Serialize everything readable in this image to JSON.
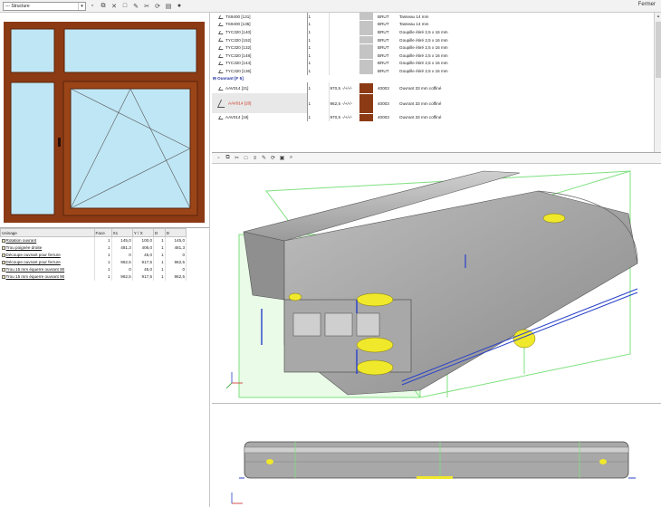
{
  "toolbar": {
    "structure_value": "--- Structure",
    "close_label": "Fermer"
  },
  "attributes": {
    "columns": [
      "Usinage",
      "Face",
      "X1",
      "Y / X",
      "D",
      "D"
    ],
    "rows": [
      {
        "label": "Rotation ouvrant",
        "face": "1",
        "x1": "145,0",
        "y": "100,0",
        "d1": "1",
        "d2": "145,0"
      },
      {
        "label": "Trou poignée droite",
        "face": "1",
        "x1": "481,3",
        "y": "406,0",
        "d1": "1",
        "d2": "481,3"
      },
      {
        "label": "Découpe ouvrant pour ferrure",
        "face": "1",
        "x1": "0",
        "y": "45,0",
        "d1": "1",
        "d2": "0"
      },
      {
        "label": "Découpe ouvrant pour ferrure",
        "face": "1",
        "x1": "962,5",
        "y": "917,5",
        "d1": "1",
        "d2": "962,5"
      },
      {
        "label": "Trou 15 mm équerre ouvrant 90",
        "face": "1",
        "x1": "0",
        "y": "45,0",
        "d1": "1",
        "d2": "0"
      },
      {
        "label": "Trou 15 mm équerre ouvrant 90",
        "face": "1",
        "x1": "962,5",
        "y": "917,5",
        "d1": "1",
        "d2": "962,5"
      }
    ]
  },
  "profiles": {
    "rows": [
      {
        "name": "TS9400 [131]",
        "qty": "1",
        "len": "",
        "ang": "",
        "swatch": "#c4c4c4",
        "finish": "BRUT",
        "desc": "Tasseau 14 mm"
      },
      {
        "name": "TS9400 [135]",
        "qty": "1",
        "len": "",
        "ang": "",
        "swatch": "#c4c4c4",
        "finish": "BRUT",
        "desc": "Tasseau 14 mm"
      },
      {
        "name": "TYC320 [140]",
        "qty": "1",
        "len": "",
        "ang": "",
        "swatch": "#c4c4c4",
        "finish": "BRUT",
        "desc": "Goupille étiré 2,5 x 16 mm"
      },
      {
        "name": "TYC320 [152]",
        "qty": "1",
        "len": "",
        "ang": "",
        "swatch": "#c4c4c4",
        "finish": "BRUT",
        "desc": "Goupille étiré 2,5 x 16 mm"
      },
      {
        "name": "TYC320 [132]",
        "qty": "1",
        "len": "",
        "ang": "",
        "swatch": "#c4c4c4",
        "finish": "BRUT",
        "desc": "Goupille étiré 2,5 x 16 mm"
      },
      {
        "name": "TYC320 [148]",
        "qty": "1",
        "len": "",
        "ang": "",
        "swatch": "#c4c4c4",
        "finish": "BRUT",
        "desc": "Goupille étiré 2,5 x 16 mm"
      },
      {
        "name": "TYC320 [144]",
        "qty": "1",
        "len": "",
        "ang": "",
        "swatch": "#c4c4c4",
        "finish": "BRUT",
        "desc": "Goupille étiré 2,5 x 16 mm"
      },
      {
        "name": "TYC320 [136]",
        "qty": "1",
        "len": "",
        "ang": "",
        "swatch": "#c4c4c4",
        "finish": "BRUT",
        "desc": "Goupille étiré 2,5 x 16 mm"
      }
    ],
    "group_label": "Ouvrant [F 5]",
    "group_rows": [
      {
        "name": "AAV014 [21]",
        "qty": "1",
        "len": "970,5",
        "ang": "-/+/-/-",
        "swatch": "#8c3a14",
        "finish": "40003",
        "desc": "Ouvrant 33 mm coffiné"
      },
      {
        "name": "AAV014 [20]",
        "qty": "1",
        "len": "962,5",
        "ang": "-/+/-/-",
        "swatch": "#8c3a14",
        "finish": "40003",
        "desc": "Ouvrant 33 mm coffiné"
      },
      {
        "name": "AAV014 [19]",
        "qty": "1",
        "len": "970,5",
        "ang": "-/+/-/-",
        "swatch": "#8c3a14",
        "finish": "40003",
        "desc": "Ouvrant 33 mm coffiné"
      }
    ]
  },
  "colors": {
    "frame_brown": "#8c3a14",
    "glass": "#bfe6f5",
    "profile_grey": "#a3a3a3",
    "seal_yellow": "#f0e82a",
    "bbox_green": "#7fe07f",
    "axis_blue": "#2840c8"
  },
  "icons": [
    "chevron-down-icon",
    "new-icon",
    "copy-icon",
    "delete-icon",
    "cut-icon",
    "pen-icon",
    "refresh-icon",
    "print-icon",
    "help-icon",
    "zoom-icon",
    "cube-icon",
    "layers-icon",
    "close-icon"
  ]
}
